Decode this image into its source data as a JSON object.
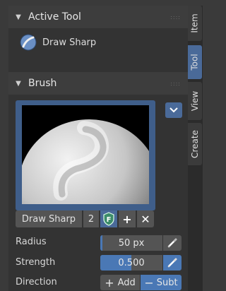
{
  "active_tool": {
    "title": "Active Tool",
    "tool_name": "Draw Sharp",
    "tool_icon": "draw-sharp-tool-icon"
  },
  "brush": {
    "title": "Brush",
    "name": "Draw Sharp",
    "users": "2",
    "fake_user_icon": "fake-user-shield-icon",
    "new_icon": "plus-icon",
    "unlink_icon": "x-icon",
    "expand_icon": "chevron-down-icon",
    "radius": {
      "label": "Radius",
      "value": "50 px"
    },
    "strength": {
      "label": "Strength",
      "value": "0.500",
      "fraction": 0.5
    },
    "direction": {
      "label": "Direction",
      "add": "Add",
      "subt": "Subt",
      "selected": "Subt"
    }
  },
  "sidebar": {
    "tabs": [
      {
        "label": "Item",
        "active": false
      },
      {
        "label": "Tool",
        "active": true
      },
      {
        "label": "View",
        "active": false
      },
      {
        "label": "Create",
        "active": false
      }
    ]
  },
  "colors": {
    "accent": "#4a78b5",
    "panel": "#333333",
    "header": "#3d3d3d"
  }
}
